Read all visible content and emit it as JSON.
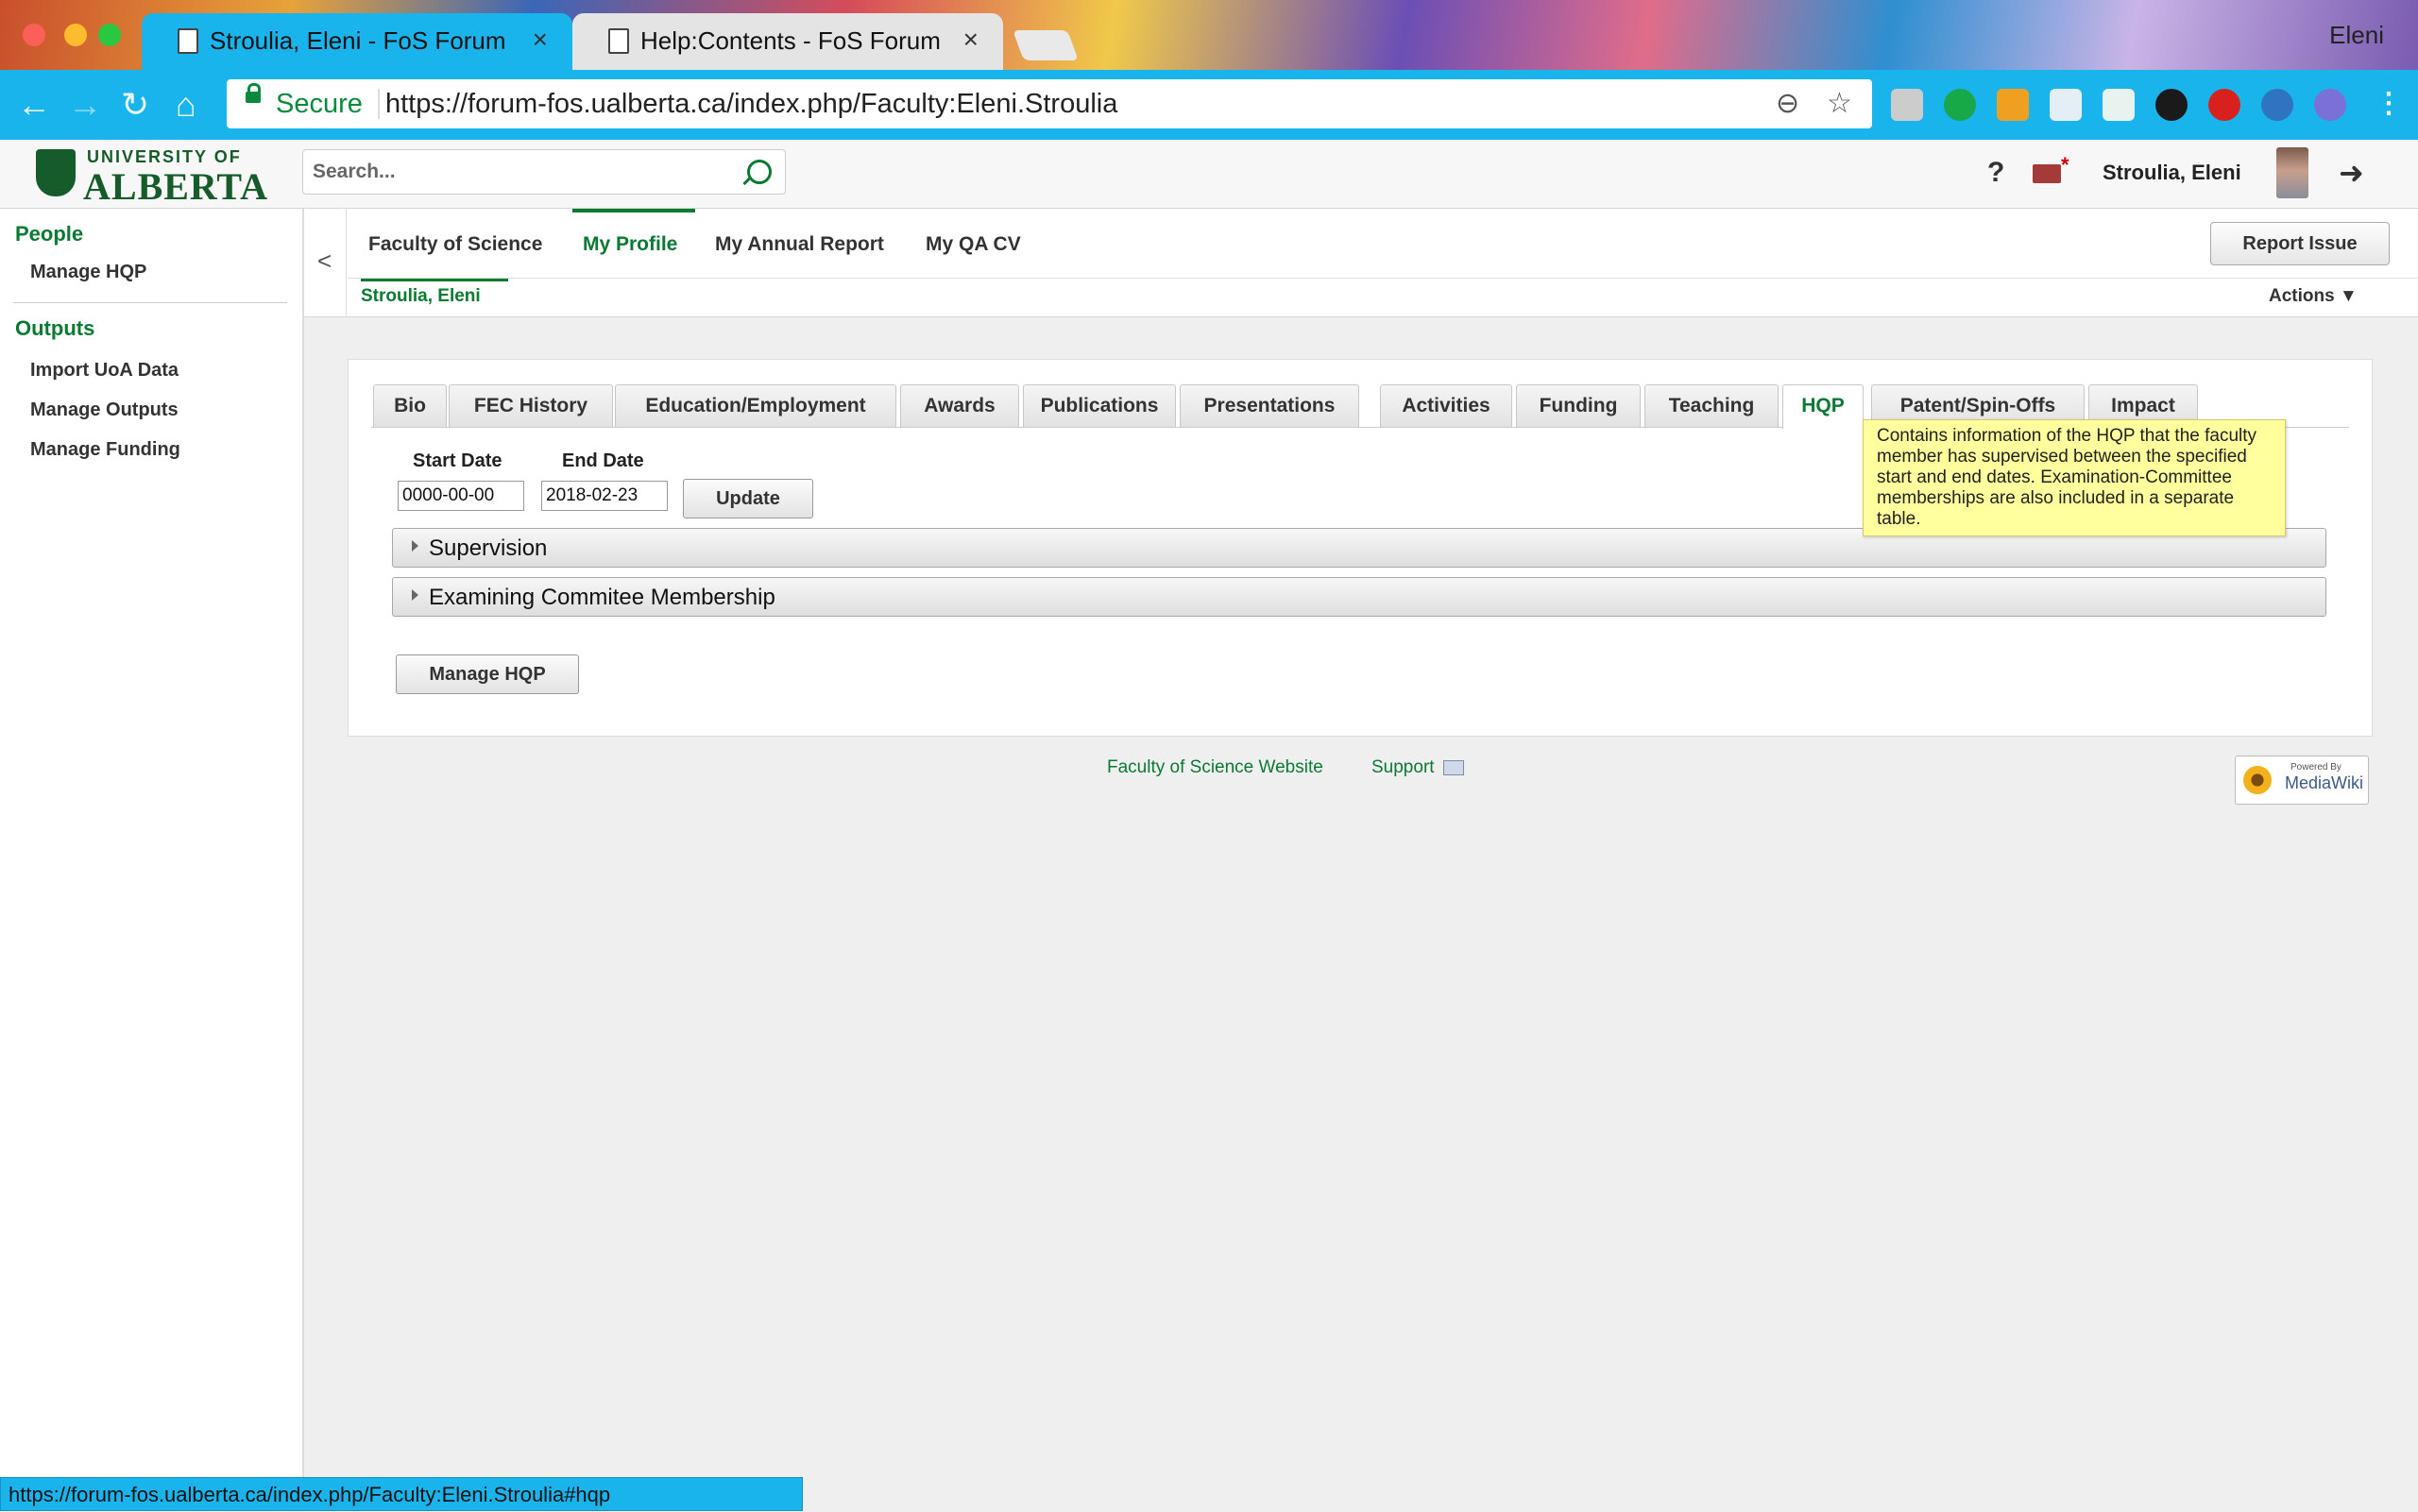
{
  "browser": {
    "tabs": [
      {
        "title": "Stroulia, Eleni - FoS Forum"
      },
      {
        "title": "Help:Contents - FoS Forum"
      }
    ],
    "profile_name": "Eleni",
    "secure_label": "Secure",
    "url": "https://forum-fos.ualberta.ca/index.php/Faculty:Eleni.Stroulia",
    "status_url": "https://forum-fos.ualberta.ca/index.php/Faculty:Eleni.Stroulia#hqp"
  },
  "header": {
    "logo_top": "UNIVERSITY OF",
    "logo_main": "ALBERTA",
    "search_placeholder": "Search...",
    "help": "?",
    "user_name": "Stroulia, Eleni"
  },
  "sidebar": {
    "sections": [
      {
        "heading": "People",
        "items": [
          "Manage HQP"
        ]
      },
      {
        "heading": "Outputs",
        "items": [
          "Import UoA Data",
          "Manage Outputs",
          "Manage Funding"
        ]
      }
    ]
  },
  "topnav": {
    "collapse": "<",
    "items": [
      "Faculty of Science",
      "My Profile",
      "My Annual Report",
      "My QA CV"
    ],
    "active": "My Profile",
    "subnav": "Stroulia, Eleni",
    "report_issue": "Report Issue",
    "actions": "Actions ▼"
  },
  "profile": {
    "tabs": [
      "Bio",
      "FEC History",
      "Education/Employment",
      "Awards",
      "Publications",
      "Presentations",
      "Activities",
      "Funding",
      "Teaching",
      "HQP",
      "Patent/Spin-Offs",
      "Impact"
    ],
    "selected_tab": "HQP",
    "start_date_label": "Start Date",
    "end_date_label": "End Date",
    "start_date": "0000-00-00",
    "end_date": "2018-02-23",
    "update_label": "Update",
    "sections": [
      "Supervision",
      "Examining Commitee Membership"
    ],
    "manage_hqp_label": "Manage HQP",
    "tooltip": "Contains information of the HQP that the faculty member has supervised between the specified start and end dates. Examination-Committee memberships are also included in a separate table."
  },
  "footer": {
    "links": [
      "Faculty of Science Website",
      "Support"
    ],
    "badge_small": "Powered By",
    "badge_name": "MediaWiki"
  }
}
